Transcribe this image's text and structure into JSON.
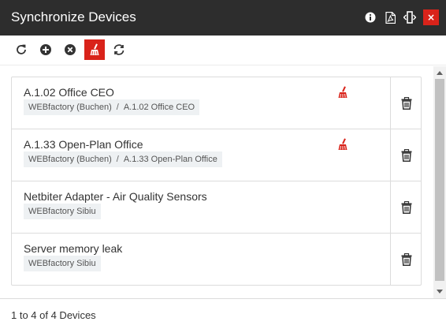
{
  "window": {
    "title": "Synchronize Devices",
    "title_icons": [
      "info-icon",
      "pdf-icon",
      "column-resize-icon"
    ],
    "close_label": "×"
  },
  "toolbar": {
    "tools": [
      "refresh-icon",
      "add-circle-icon",
      "remove-circle-icon",
      "broom-icon",
      "sync-icon"
    ],
    "active_tool": "broom-icon",
    "accent_color": "#d9231a"
  },
  "devices": [
    {
      "name": "A.1.02 Office CEO",
      "path": [
        "WEBfactory (Buchen)",
        "A.1.02 Office CEO"
      ],
      "status_icon": "broom-icon"
    },
    {
      "name": "A.1.33 Open-Plan Office",
      "path": [
        "WEBfactory (Buchen)",
        "A.1.33 Open-Plan Office"
      ],
      "status_icon": "broom-icon"
    },
    {
      "name": "Netbiter Adapter - Air Quality Sensors",
      "path": [
        "WEBfactory Sibiu"
      ],
      "status_icon": null
    },
    {
      "name": "Server memory leak",
      "path": [
        "WEBfactory Sibiu"
      ],
      "status_icon": null
    }
  ],
  "path_separator": "/",
  "row_action_icon": "trash-icon",
  "footer": {
    "summary": "1 to 4 of 4 Devices"
  }
}
